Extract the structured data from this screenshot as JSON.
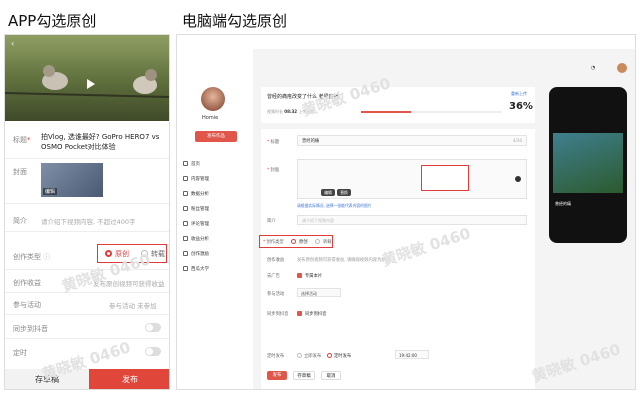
{
  "left_title": "APP勾选原创",
  "right_title": "电脑端勾选原创",
  "watermark": "黄晓敏 0460",
  "app": {
    "title_label": "标题",
    "title_value": "拍Vlog, 选谁最好? GoPro HERO7 vs OSMO Pocket对比体验",
    "cover_label": "封面",
    "cover_edit": "编辑",
    "intro_label": "简介",
    "intro_placeholder": "请介绍下视频内容, 不超过400字",
    "type_label": "创作类型",
    "type_options": [
      "原创",
      "转载"
    ],
    "revenue_label": "创作收益",
    "revenue_value": "发布原创视频可获得收益",
    "activity_label": "参与活动",
    "activity_value": "参与活动 未参加",
    "sync_label": "同步到抖音",
    "timer_label": "定时",
    "save_draft": "存草稿",
    "publish": "发布"
  },
  "pc": {
    "user_name": "Homie",
    "publish_btn": "发布作品",
    "menu": [
      "首页",
      "内容管理",
      "数据分析",
      "粉丝管理",
      "评论管理",
      "收益分析",
      "创作激励",
      "西瓜大学"
    ],
    "upload_title": "曾经的痛疮改变了什么 老梁直播",
    "upload_meta": [
      "视频时长",
      "08:32",
      "上传进度"
    ],
    "upload_pct": "36%",
    "upload_cancel": "重新上传",
    "form_title_label": "标题",
    "form_title_value": "曾经的痛",
    "form_title_count": "4/30",
    "form_cover_label": "封面",
    "cover_btns": [
      "编辑",
      "替换"
    ],
    "cover_hint": "请根据实际情况, 选择一张能代表内容的图片",
    "intro_label": "简介",
    "intro_placeholder": "请介绍下视频内容",
    "type_label": "创作类型",
    "type_options": [
      "原创",
      "转载"
    ],
    "revenue_label": "创作收益",
    "revenue_hint": "发布原创视频可获得收益, 请确保视频内容为原创",
    "ad_label": "去广告",
    "ad_value": "专属本片",
    "activity_label": "参与活动",
    "activity_value": "选择活动",
    "sync_label": "同步到抖音",
    "sync_value": "同步到抖音",
    "timer_label": "定时发布",
    "timer_options": [
      "立即发布",
      "定时发布"
    ],
    "timer_time": "19:42:00",
    "buttons": [
      "发布",
      "存草稿",
      "取消"
    ],
    "phone_caption": "曾经的痛"
  }
}
